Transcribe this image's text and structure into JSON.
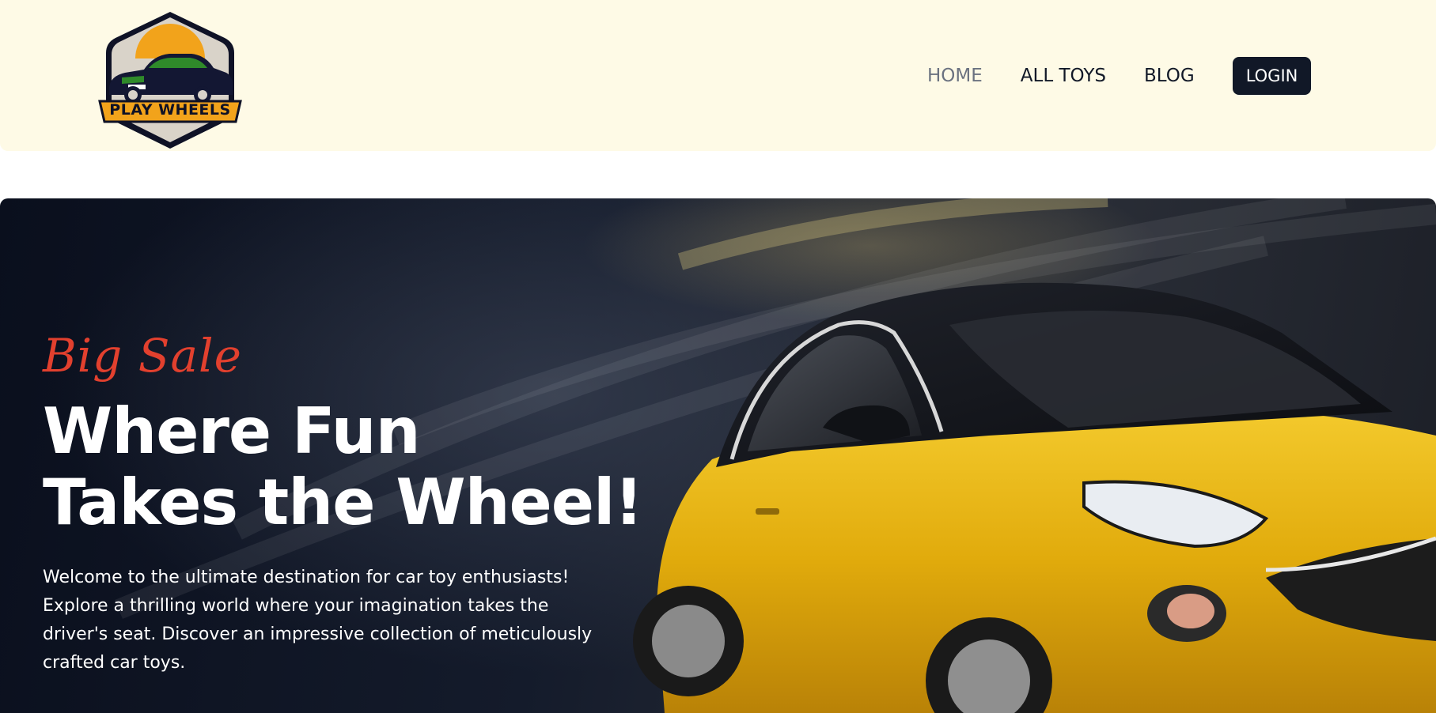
{
  "header": {
    "logo_text": "PLAY WHEELS",
    "nav": {
      "home": "HOME",
      "all_toys": "ALL TOYS",
      "blog": "BLOG"
    },
    "login_label": "LOGIN"
  },
  "hero": {
    "tagline": "Big Sale",
    "title_line1": "Where Fun",
    "title_line2": "Takes the Wheel!",
    "description": "Welcome to the ultimate destination for car toy enthusiasts! Explore a thrilling world where your imagination takes the driver's seat. Discover an impressive collection of meticulously crafted car toys."
  },
  "icons": {
    "logo": "car-badge-logo"
  },
  "colors": {
    "header_bg": "#fefae6",
    "nav_active": "#6b7280",
    "nav_text": "#111827",
    "login_bg": "#111827",
    "tagline": "#e2402e",
    "car_yellow": "#e7b10f"
  }
}
